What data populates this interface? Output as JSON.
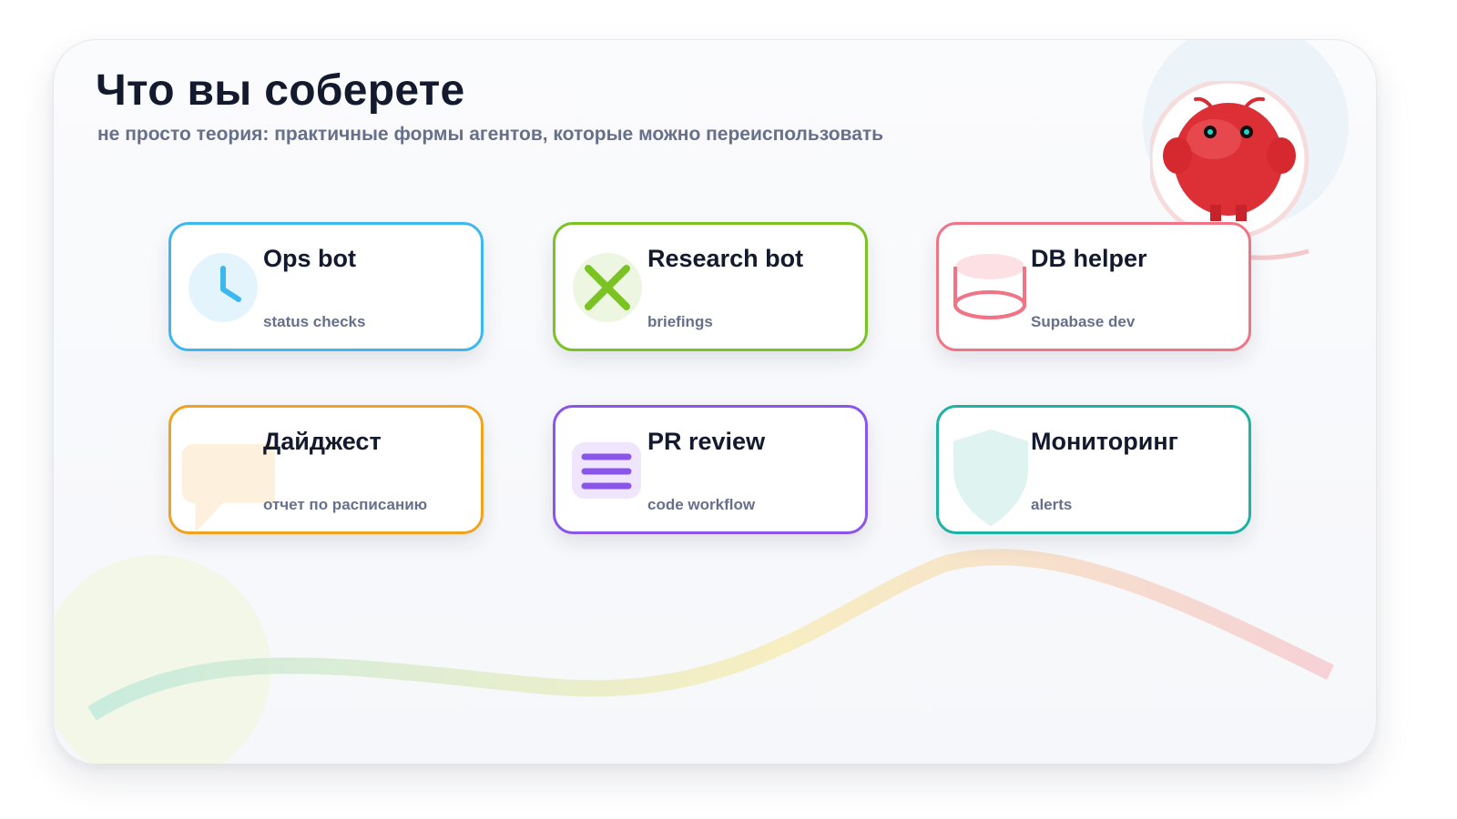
{
  "header": {
    "title": "Что вы соберете",
    "subtitle": "не просто теория: практичные формы агентов, которые можно переиспользовать"
  },
  "cards": [
    {
      "name": "Ops bot",
      "description": "status checks",
      "icon": "clock-icon",
      "accent": "#3db8ef"
    },
    {
      "name": "Research bot",
      "description": "briefings",
      "icon": "cross-icon",
      "accent": "#7ac322"
    },
    {
      "name": "DB helper",
      "description": "Supabase dev",
      "icon": "database-icon",
      "accent": "#f07486"
    },
    {
      "name": "Дайджест",
      "description": "отчет по расписанию",
      "icon": "chat-bubble-icon",
      "accent": "#f0a31e"
    },
    {
      "name": "PR review",
      "description": "code workflow",
      "icon": "list-icon",
      "accent": "#8a55ea"
    },
    {
      "name": "Мониторинг",
      "description": "alerts",
      "icon": "shield-icon",
      "accent": "#1eb2a4"
    }
  ],
  "mascot": {
    "icon": "red-bug-mascot-icon",
    "color": "#e0343a"
  }
}
